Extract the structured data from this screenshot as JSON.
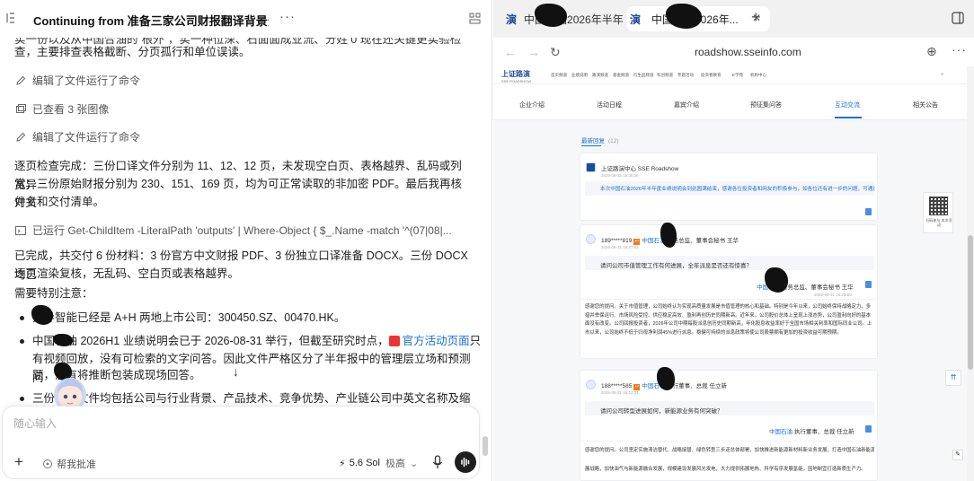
{
  "chat": {
    "title": "Continuing from 准备三家公司财报翻译背景分...",
    "more": "···",
    "lines": {
      "l0": "实一份以及从中国合油的”根外”，实一种位深、石面面成业流、分姓 0 现在还关键更实验检",
      "l1": "查，主要排查表格截断、分页孤行和单位误读。",
      "tool1": "编辑了文件运行了命令",
      "tool2": "已查看 3 张图像",
      "tool3": "编辑了文件运行了命令",
      "p1a": "逐页检查完成：三份口译文件分别为 11、12、12 页，未发现空白页、表格越界、乱码或列宽异",
      "p1b": "常；三份原始财报分别为 230、151、169 页，均为可正常读取的非加密 PDF。最后我再核对文",
      "p1c": "件名和交付清单。",
      "tool4": "已运行 Get-ChildItem -LiteralPath 'outputs' | Where-Object { $_.Name -match '^(07|08|...",
      "p2a": "已完成，共交付 6 份材料：3 份官方中文财报 PDF、3 份独立口译准备 DOCX。三份 DOCX 均已",
      "p2b": "逐页渲染复核，无乱码、空白页或表格越界。",
      "p3": "需要特别注意：",
      "b1": "先导智能已经是 A+H 两地上市公司：300450.SZ、00470.HK。",
      "b2a_pre": "中国石油 2026H1 业绩说明会已于 2026-08-31 举行，但截至研究时点，",
      "b2a_link": "官方活动页面",
      "b2a_post": "只",
      "b2b": "有视频回放，没有可检索的文字问答。因此文件严格区分了半年报中的管理层立场和预测问",
      "b2c": "题，没有将推断包装成现场回答。",
      "b3": "三份口译文件均包括公司与行业背景、产品技术、竞争优势、产业链公司中英文名称及缩"
    },
    "composer": {
      "placeholder": "随心输入",
      "help": "帮我批准",
      "model": "5.6 Sol",
      "mode": "极高"
    }
  },
  "browser": {
    "tab1_label": "中国石油2026年半年...",
    "tab2_label": "中国石油2026年...",
    "tab_favicon": "演",
    "url": "roadshow.sseinfo.com",
    "site": {
      "logo": "上证路演",
      "logo_sub": "SSE ROADSHOW",
      "topnav": [
        "首页频道",
        "业绩说明",
        "路演频道",
        "基金频道",
        "衍生品频道",
        "科创频道",
        "专题活动",
        "投资者教育",
        "E学苑",
        "机构中心"
      ],
      "tabs": [
        "企业介绍",
        "活动日程",
        "嘉宾介绍",
        "预征集问答",
        "互动交流",
        "相关公告"
      ],
      "latest_reply": "最新回复",
      "reply_count": "(12)",
      "card1": {
        "user": "上证路演中心 SSE Roadshow",
        "time": "2026-08-31 16:35:36",
        "text": "本次中国石油2026年半年度业绩说明会到此圆满结束，感谢各位投资者和网友的积极参与，如各位还有进一步的问题，可通过上证e互动"
      },
      "card2": {
        "user": "189*****819",
        "company": "中国石油",
        "role": "财务总监、董事会秘书 王华",
        "time": "2026-08-31 16:27:01",
        "question": "请问公司市值管理工作有何进展，全年派息是否还有惊喜？",
        "a_company": "中国石油",
        "a_role": "财务总监、董事会秘书 王华",
        "a_time": "2026-08-31 16:28:59",
        "answer": "感谢您的提问。关于市值管理，公司始终认为实现高质量发展是市值管理的核心和基础。特别是今年以来，公司始终保持战略定力，多措并举保运行、市场风险受控、供应稳定高效、盈利再创历史同期新高。近年来，公司股价总体上呈现上涨态势，公司盈利向好的基本面没有改变。公司回报投资者，2026年公司中期每股派息创历史同期新高，年化股息收益率好于全国市场相关利率和国际同业公司。上市以来，公司始终不低于归母净利润45%进行派息。稳健可持续的派息政策将使公司股票拥有更加的投资收益可期预期。"
      },
      "card3": {
        "user": "188*****585",
        "company": "中国石油",
        "role": "执行董事、总裁 任立新",
        "time": "2026-08-31 16:12:31",
        "question": "请问公司转型进展如何，新能源业务有何突破？",
        "a_company": "中国石油",
        "a_role": "执行董事、总裁 任立新",
        "answer_1": "感谢您的提问。公司坚定实施清洁替代、战略接替、绿色转型三步走总体部署，加快推进新能源新材料新业务发展，打造中国石油新能源业务，形成投资绿电资源、盘活电厂、智能微电网等新业态。",
        "answer_2": "展战略，加快油气与新能源融合发展，规模建设发展风光发电，大力提供拓展地热、科学有序发展氢能，因地制宜打造新质生产力。"
      },
      "qr_caption": "扫码参与 本次活动"
    }
  },
  "colors": {
    "accent": "#1a6fd8",
    "badge": "#f27b1a",
    "dark": "#1f1f1f"
  }
}
